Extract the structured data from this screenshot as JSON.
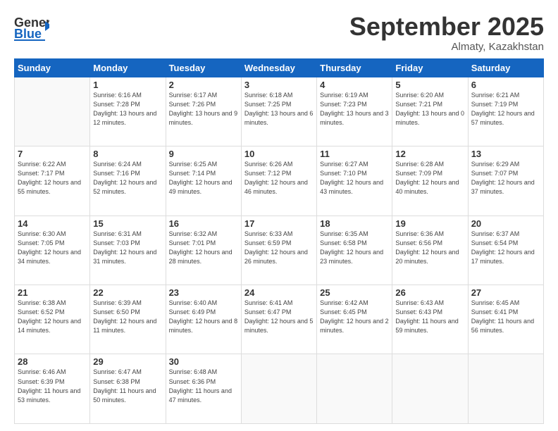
{
  "header": {
    "logo_general": "General",
    "logo_blue": "Blue",
    "month_title": "September 2025",
    "location": "Almaty, Kazakhstan"
  },
  "weekdays": [
    "Sunday",
    "Monday",
    "Tuesday",
    "Wednesday",
    "Thursday",
    "Friday",
    "Saturday"
  ],
  "weeks": [
    [
      {
        "day": null
      },
      {
        "day": "1",
        "sunrise": "6:16 AM",
        "sunset": "7:28 PM",
        "daylight": "13 hours and 12 minutes."
      },
      {
        "day": "2",
        "sunrise": "6:17 AM",
        "sunset": "7:26 PM",
        "daylight": "13 hours and 9 minutes."
      },
      {
        "day": "3",
        "sunrise": "6:18 AM",
        "sunset": "7:25 PM",
        "daylight": "13 hours and 6 minutes."
      },
      {
        "day": "4",
        "sunrise": "6:19 AM",
        "sunset": "7:23 PM",
        "daylight": "13 hours and 3 minutes."
      },
      {
        "day": "5",
        "sunrise": "6:20 AM",
        "sunset": "7:21 PM",
        "daylight": "13 hours and 0 minutes."
      },
      {
        "day": "6",
        "sunrise": "6:21 AM",
        "sunset": "7:19 PM",
        "daylight": "12 hours and 57 minutes."
      }
    ],
    [
      {
        "day": "7",
        "sunrise": "6:22 AM",
        "sunset": "7:17 PM",
        "daylight": "12 hours and 55 minutes."
      },
      {
        "day": "8",
        "sunrise": "6:24 AM",
        "sunset": "7:16 PM",
        "daylight": "12 hours and 52 minutes."
      },
      {
        "day": "9",
        "sunrise": "6:25 AM",
        "sunset": "7:14 PM",
        "daylight": "12 hours and 49 minutes."
      },
      {
        "day": "10",
        "sunrise": "6:26 AM",
        "sunset": "7:12 PM",
        "daylight": "12 hours and 46 minutes."
      },
      {
        "day": "11",
        "sunrise": "6:27 AM",
        "sunset": "7:10 PM",
        "daylight": "12 hours and 43 minutes."
      },
      {
        "day": "12",
        "sunrise": "6:28 AM",
        "sunset": "7:09 PM",
        "daylight": "12 hours and 40 minutes."
      },
      {
        "day": "13",
        "sunrise": "6:29 AM",
        "sunset": "7:07 PM",
        "daylight": "12 hours and 37 minutes."
      }
    ],
    [
      {
        "day": "14",
        "sunrise": "6:30 AM",
        "sunset": "7:05 PM",
        "daylight": "12 hours and 34 minutes."
      },
      {
        "day": "15",
        "sunrise": "6:31 AM",
        "sunset": "7:03 PM",
        "daylight": "12 hours and 31 minutes."
      },
      {
        "day": "16",
        "sunrise": "6:32 AM",
        "sunset": "7:01 PM",
        "daylight": "12 hours and 28 minutes."
      },
      {
        "day": "17",
        "sunrise": "6:33 AM",
        "sunset": "6:59 PM",
        "daylight": "12 hours and 26 minutes."
      },
      {
        "day": "18",
        "sunrise": "6:35 AM",
        "sunset": "6:58 PM",
        "daylight": "12 hours and 23 minutes."
      },
      {
        "day": "19",
        "sunrise": "6:36 AM",
        "sunset": "6:56 PM",
        "daylight": "12 hours and 20 minutes."
      },
      {
        "day": "20",
        "sunrise": "6:37 AM",
        "sunset": "6:54 PM",
        "daylight": "12 hours and 17 minutes."
      }
    ],
    [
      {
        "day": "21",
        "sunrise": "6:38 AM",
        "sunset": "6:52 PM",
        "daylight": "12 hours and 14 minutes."
      },
      {
        "day": "22",
        "sunrise": "6:39 AM",
        "sunset": "6:50 PM",
        "daylight": "12 hours and 11 minutes."
      },
      {
        "day": "23",
        "sunrise": "6:40 AM",
        "sunset": "6:49 PM",
        "daylight": "12 hours and 8 minutes."
      },
      {
        "day": "24",
        "sunrise": "6:41 AM",
        "sunset": "6:47 PM",
        "daylight": "12 hours and 5 minutes."
      },
      {
        "day": "25",
        "sunrise": "6:42 AM",
        "sunset": "6:45 PM",
        "daylight": "12 hours and 2 minutes."
      },
      {
        "day": "26",
        "sunrise": "6:43 AM",
        "sunset": "6:43 PM",
        "daylight": "11 hours and 59 minutes."
      },
      {
        "day": "27",
        "sunrise": "6:45 AM",
        "sunset": "6:41 PM",
        "daylight": "11 hours and 56 minutes."
      }
    ],
    [
      {
        "day": "28",
        "sunrise": "6:46 AM",
        "sunset": "6:39 PM",
        "daylight": "11 hours and 53 minutes."
      },
      {
        "day": "29",
        "sunrise": "6:47 AM",
        "sunset": "6:38 PM",
        "daylight": "11 hours and 50 minutes."
      },
      {
        "day": "30",
        "sunrise": "6:48 AM",
        "sunset": "6:36 PM",
        "daylight": "11 hours and 47 minutes."
      },
      {
        "day": null
      },
      {
        "day": null
      },
      {
        "day": null
      },
      {
        "day": null
      }
    ]
  ]
}
